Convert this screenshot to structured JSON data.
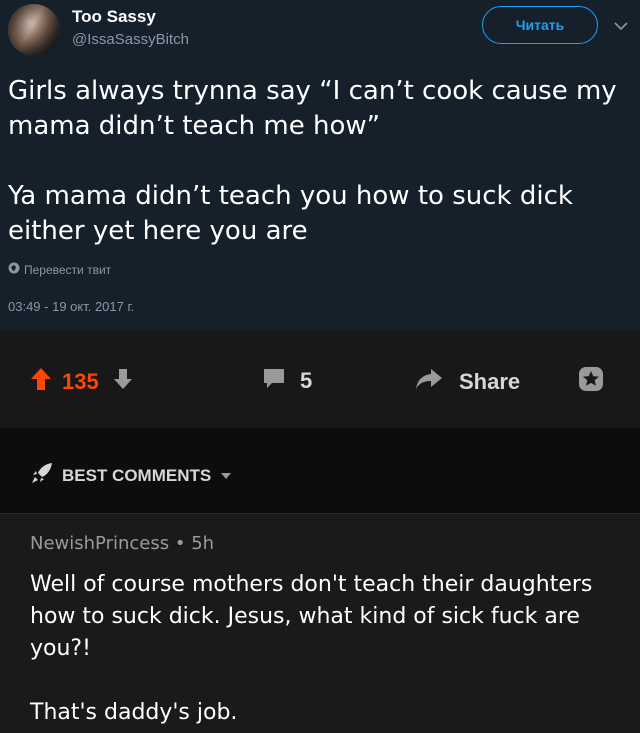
{
  "tweet": {
    "author_name": "Too Sassy",
    "author_handle": "@IssaSassyBitch",
    "follow_label": "Читать",
    "text": "Girls always trynna say “I can’t cook cause my mama didn’t teach me how”\n\nYa mama didn’t teach you how to suck dick either yet here you are",
    "translate_label": "Перевести твит",
    "timestamp": "03:49 - 19 окт. 2017 г."
  },
  "actions": {
    "upvotes": "135",
    "comments": "5",
    "share_label": "Share"
  },
  "best_comments": {
    "label": "BEST COMMENTS"
  },
  "comment": {
    "author": "NewishPrincess",
    "age": "5h",
    "separator": "•",
    "text": "Well of course mothers don't teach their daughters how to suck dick. Jesus, what kind of sick fuck are you?!\n\nThat's daddy's job."
  },
  "colors": {
    "tweet_bg": "#15202b",
    "accent_blue": "#1da1f2",
    "upvote_orange": "#ff4500",
    "muted_gray": "#8899a6"
  }
}
